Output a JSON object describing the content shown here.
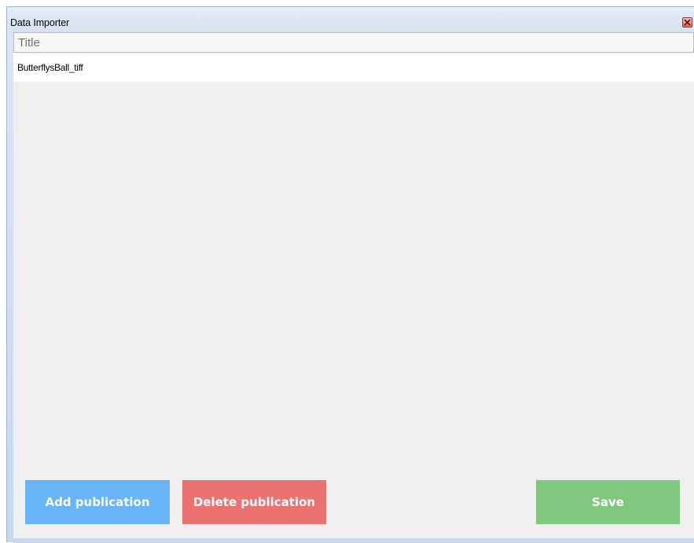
{
  "window": {
    "title": "Data Importer",
    "close_icon": "close-icon"
  },
  "table": {
    "columns": [
      "Title"
    ],
    "rows": [
      {
        "title": "ButterflysBall_tiff"
      }
    ]
  },
  "buttons": {
    "add_label": "Add publication",
    "delete_label": "Delete publication",
    "save_label": "Save"
  },
  "colors": {
    "add": "#67b5f8",
    "delete": "#ec7272",
    "save": "#80c880",
    "content_bg": "#efefef",
    "titlebar": "#d6e2f2"
  }
}
